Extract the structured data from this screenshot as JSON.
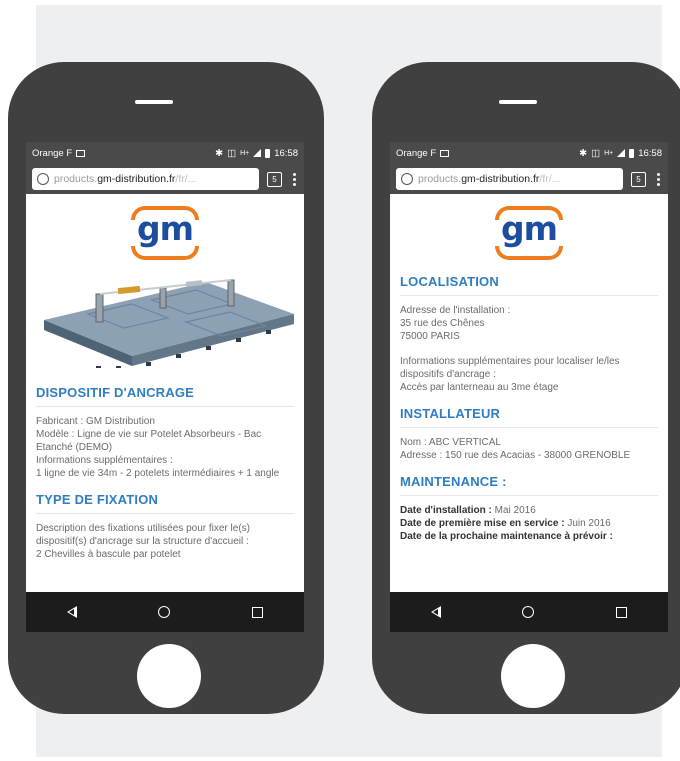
{
  "status_bar": {
    "carrier": "Orange F",
    "network": "H+",
    "time": "16:58"
  },
  "browser": {
    "url_prefix": "products.",
    "url_host": "gm-distribution.fr",
    "url_rest": "/fr/...",
    "tab_count": "5"
  },
  "brand": {
    "logo_text": "gm",
    "logo_color": "#1d4d9e",
    "accent_color": "#ee7d1d"
  },
  "left_screen": {
    "sections": [
      {
        "title": "DISPOSITIF D'ANCRAGE",
        "lines": [
          "Fabricant : GM Distribution",
          "Modèle : Ligne de vie sur Potelet Absorbeurs - Bac Etanché (DEMO)",
          "Informations supplémentaires :",
          "1 ligne de vie 34m - 2 potelets intermédiaires + 1 angle"
        ]
      },
      {
        "title": "TYPE DE FIXATION",
        "lines": [
          "Description des fixations utilisées pour fixer le(s) dispositif(s) d'ancrage sur la structure d'accueil :",
          "2 Chevilles à bascule par potelet"
        ]
      }
    ]
  },
  "right_screen": {
    "sections": [
      {
        "title": "LOCALISATION",
        "para1": [
          "Adresse de l'installation :",
          "35 rue des Chênes",
          "75000 PARIS"
        ],
        "para2": [
          "Informations supplémentaires pour localiser le/les dispositifs d'ancrage :",
          "Accès par lanterneau au 3me étage"
        ]
      },
      {
        "title": "INSTALLATEUR",
        "lines": [
          "Nom : ABC VERTICAL",
          "Adresse : 150 rue des Acacias - 38000 GRENOBLE"
        ]
      },
      {
        "title": "MAINTENANCE :",
        "items": [
          {
            "label": "Date d'installation :",
            "value": "Mai 2016"
          },
          {
            "label": "Date de première mise en service :",
            "value": "Juin 2016"
          },
          {
            "label": "Date de la prochaine maintenance à prévoir :",
            "value": ""
          }
        ]
      }
    ]
  },
  "icons": {
    "status_left": "image-notification-icon",
    "status_right": [
      "bluetooth-icon",
      "vibrate-icon",
      "signal-icon",
      "battery-icon"
    ],
    "browser": [
      "globe-icon",
      "tabs-icon",
      "menu-icon"
    ],
    "nav": [
      "back-icon",
      "home-icon",
      "recents-icon"
    ]
  }
}
